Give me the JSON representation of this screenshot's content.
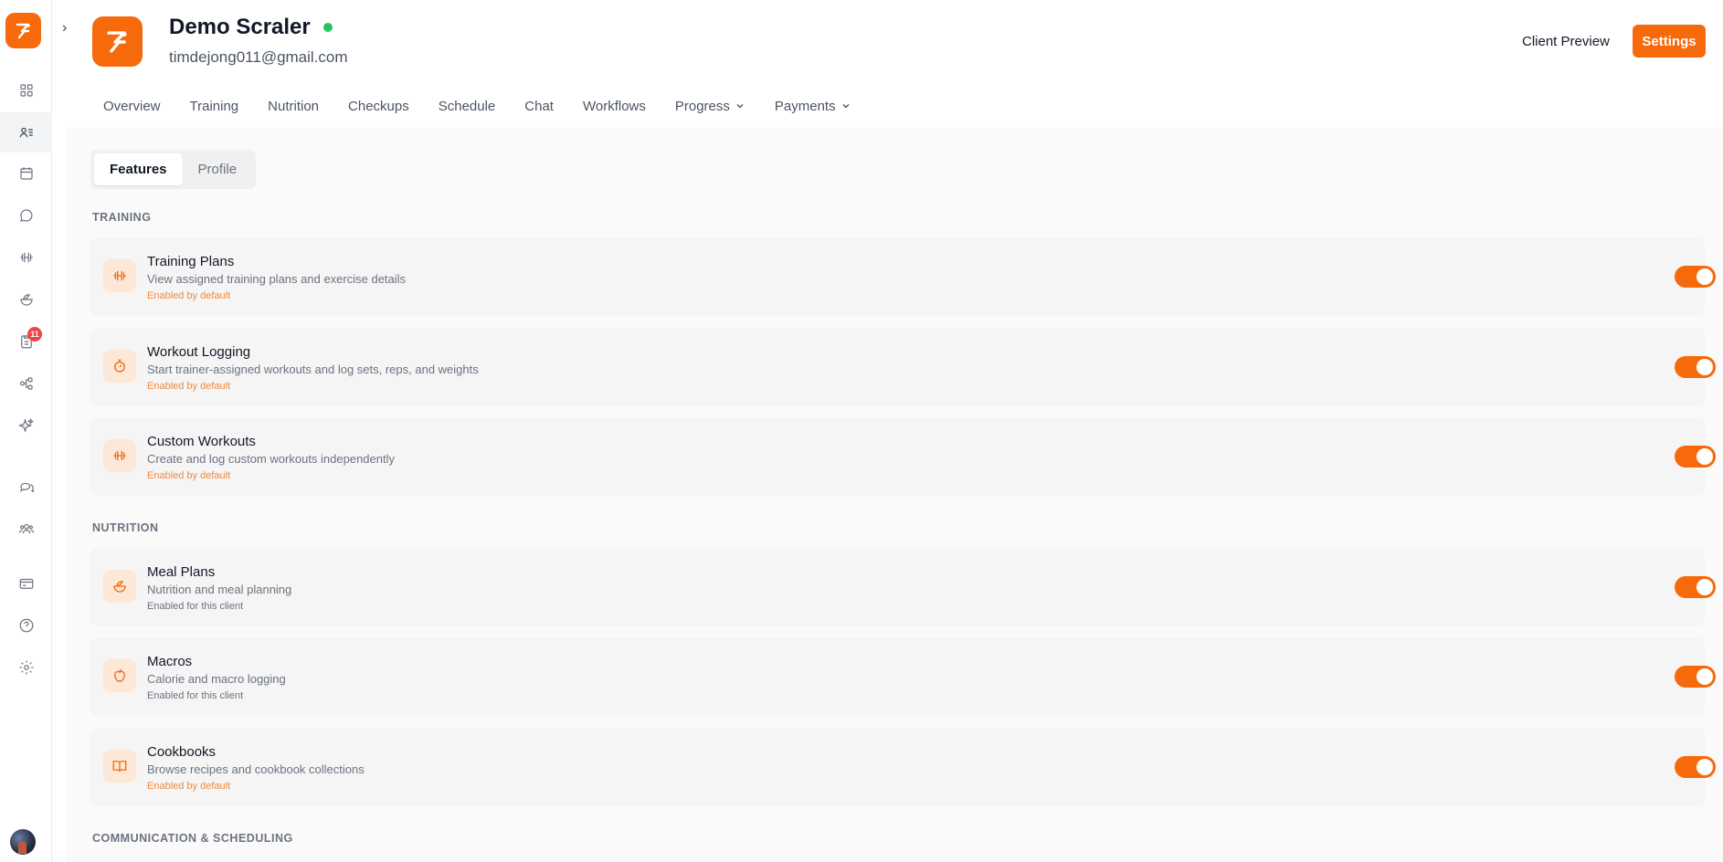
{
  "header": {
    "client_name": "Demo Scraler",
    "client_email": "timdejong011@gmail.com",
    "status": "online",
    "client_preview_label": "Client Preview",
    "settings_label": "Settings"
  },
  "nav_tabs": [
    {
      "label": "Overview",
      "has_dropdown": false
    },
    {
      "label": "Training",
      "has_dropdown": false
    },
    {
      "label": "Nutrition",
      "has_dropdown": false
    },
    {
      "label": "Checkups",
      "has_dropdown": false
    },
    {
      "label": "Schedule",
      "has_dropdown": false
    },
    {
      "label": "Chat",
      "has_dropdown": false
    },
    {
      "label": "Workflows",
      "has_dropdown": false
    },
    {
      "label": "Progress",
      "has_dropdown": true
    },
    {
      "label": "Payments",
      "has_dropdown": true
    }
  ],
  "segmented": {
    "features": "Features",
    "profile": "Profile",
    "active": "Features"
  },
  "sidebar": {
    "items": [
      {
        "icon": "dashboard-grid-icon"
      },
      {
        "icon": "clients-list-icon",
        "active": true
      },
      {
        "icon": "calendar-icon"
      },
      {
        "icon": "chat-bubble-icon"
      },
      {
        "icon": "dumbbell-icon"
      },
      {
        "icon": "salad-bowl-icon"
      },
      {
        "icon": "clipboard-icon",
        "badge": "11"
      },
      {
        "icon": "workflow-icon"
      },
      {
        "icon": "sparkles-icon"
      },
      {
        "icon": "messages-icon"
      },
      {
        "icon": "team-icon"
      },
      {
        "icon": "credit-card-icon"
      },
      {
        "icon": "help-circle-icon"
      },
      {
        "icon": "settings-gear-icon"
      }
    ]
  },
  "sections": {
    "training": {
      "heading": "TRAINING",
      "features": [
        {
          "title": "Training Plans",
          "description": "View assigned training plans and exercise details",
          "status": "Enabled by default",
          "icon": "dumbbell-icon",
          "enabled": true
        },
        {
          "title": "Workout Logging",
          "description": "Start trainer-assigned workouts and log sets, reps, and weights",
          "status": "Enabled by default",
          "icon": "stopwatch-icon",
          "enabled": true
        },
        {
          "title": "Custom Workouts",
          "description": "Create and log custom workouts independently",
          "status": "Enabled by default",
          "icon": "dumbbell-icon",
          "enabled": true
        }
      ]
    },
    "nutrition": {
      "heading": "NUTRITION",
      "features": [
        {
          "title": "Meal Plans",
          "description": "Nutrition and meal planning",
          "status": "Enabled for this client",
          "icon": "salad-bowl-icon",
          "enabled": true
        },
        {
          "title": "Macros",
          "description": "Calorie and macro logging",
          "status": "Enabled for this client",
          "icon": "apple-icon",
          "enabled": true
        },
        {
          "title": "Cookbooks",
          "description": "Browse recipes and cookbook collections",
          "status": "Enabled by default",
          "icon": "book-open-icon",
          "enabled": true
        }
      ]
    },
    "communication": {
      "heading": "COMMUNICATION & SCHEDULING"
    }
  },
  "colors": {
    "accent": "#f66a0c",
    "online": "#22c55e",
    "badge": "#ef4444"
  }
}
